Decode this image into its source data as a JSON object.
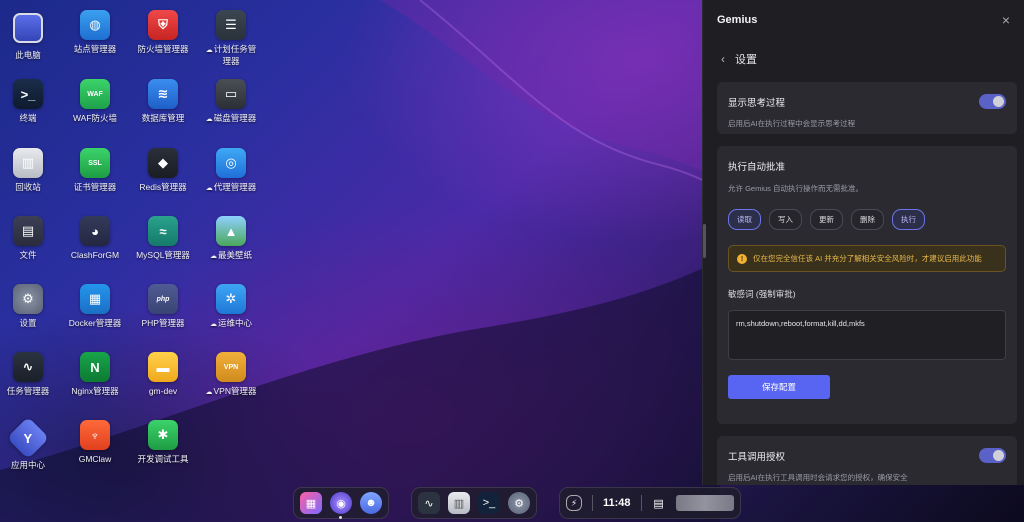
{
  "desktop": {
    "icons": [
      {
        "label": "此电脑",
        "glyph": "",
        "cloud": false
      },
      {
        "label": "站点管理器",
        "glyph": "◍",
        "cloud": false
      },
      {
        "label": "防火墙管理器",
        "glyph": "⛨",
        "cloud": false
      },
      {
        "label": "计划任务管理器",
        "glyph": "☰",
        "cloud": true
      },
      {
        "label": "终端",
        "glyph": ">_",
        "cloud": false
      },
      {
        "label": "WAF防火墙",
        "glyph": "WAF",
        "cloud": false
      },
      {
        "label": "数据库管理",
        "glyph": "≋",
        "cloud": false
      },
      {
        "label": "磁盘管理器",
        "glyph": "▭",
        "cloud": true
      },
      {
        "label": "回收站",
        "glyph": "▥",
        "cloud": false
      },
      {
        "label": "证书管理器",
        "glyph": "SSL",
        "cloud": false
      },
      {
        "label": "Redis管理器",
        "glyph": "◆",
        "cloud": false
      },
      {
        "label": "代理管理器",
        "glyph": "◎",
        "cloud": true
      },
      {
        "label": "文件",
        "glyph": "▤",
        "cloud": false
      },
      {
        "label": "ClashForGM",
        "glyph": "◕",
        "cloud": false
      },
      {
        "label": "MySQL管理器",
        "glyph": "≈",
        "cloud": false
      },
      {
        "label": "最美壁纸",
        "glyph": "▲",
        "cloud": true
      },
      {
        "label": "设置",
        "glyph": "⚙",
        "cloud": false
      },
      {
        "label": "Docker管理器",
        "glyph": "▦",
        "cloud": false
      },
      {
        "label": "PHP管理器",
        "glyph": "php",
        "cloud": false
      },
      {
        "label": "运维中心",
        "glyph": "✲",
        "cloud": true
      },
      {
        "label": "任务管理器",
        "glyph": "∿",
        "cloud": false
      },
      {
        "label": "Nginx管理器",
        "glyph": "N",
        "cloud": false
      },
      {
        "label": "gm-dev",
        "glyph": "▬",
        "cloud": false
      },
      {
        "label": "VPN管理器",
        "glyph": "VPN",
        "cloud": true
      },
      {
        "label": "应用中心",
        "glyph": "Y",
        "cloud": false
      },
      {
        "label": "GMClaw",
        "glyph": "♆",
        "cloud": false
      },
      {
        "label": "开发调试工具",
        "glyph": "✱",
        "cloud": false
      }
    ]
  },
  "dock": {
    "time": "11:48"
  },
  "panel": {
    "title": "Gemius",
    "close_icon": "×",
    "back_icon": "‹",
    "page_title": "设置",
    "thinking": {
      "title": "显示思考过程",
      "desc": "启用后AI在执行过程中会显示思考过程"
    },
    "auto_approve": {
      "title": "执行自动批准",
      "desc": "允许 Gemius 自动执行操作而无需批准。",
      "chips": [
        {
          "label": "读取",
          "active": true
        },
        {
          "label": "写入",
          "active": false
        },
        {
          "label": "更新",
          "active": false
        },
        {
          "label": "删除",
          "active": false
        },
        {
          "label": "执行",
          "active": true
        }
      ],
      "warning": "仅在您完全信任该 AI 并充分了解相关安全风险时，才建议启用此功能",
      "warning_icon": "!",
      "sensitive_label": "敏感词 (强制审批)",
      "sensitive_value": "rm,shutdown,reboot,format,kill,dd,mkfs",
      "save_label": "保存配置"
    },
    "tool_auth": {
      "title": "工具调用授权",
      "desc": "启用后AI在执行工具调用时会请求您的授权，确保安全"
    }
  }
}
